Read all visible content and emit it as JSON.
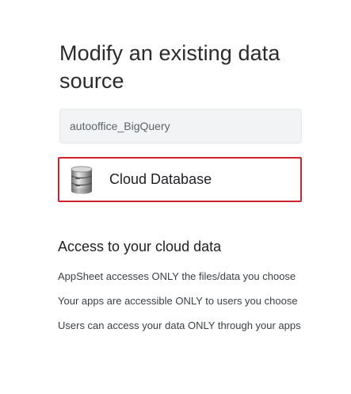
{
  "page": {
    "title": "Modify an existing data source"
  },
  "source_name": {
    "value": "autooffice_BigQuery",
    "placeholder": ""
  },
  "database_option": {
    "label": "Cloud Database",
    "icon": "database-icon",
    "highlight_color": "#d0242b"
  },
  "access_section": {
    "heading": "Access to your cloud data",
    "lines": [
      "AppSheet accesses ONLY the files/data you choose",
      "Your apps are accessible ONLY to users you choose",
      "Users can access your data ONLY through your apps"
    ]
  }
}
